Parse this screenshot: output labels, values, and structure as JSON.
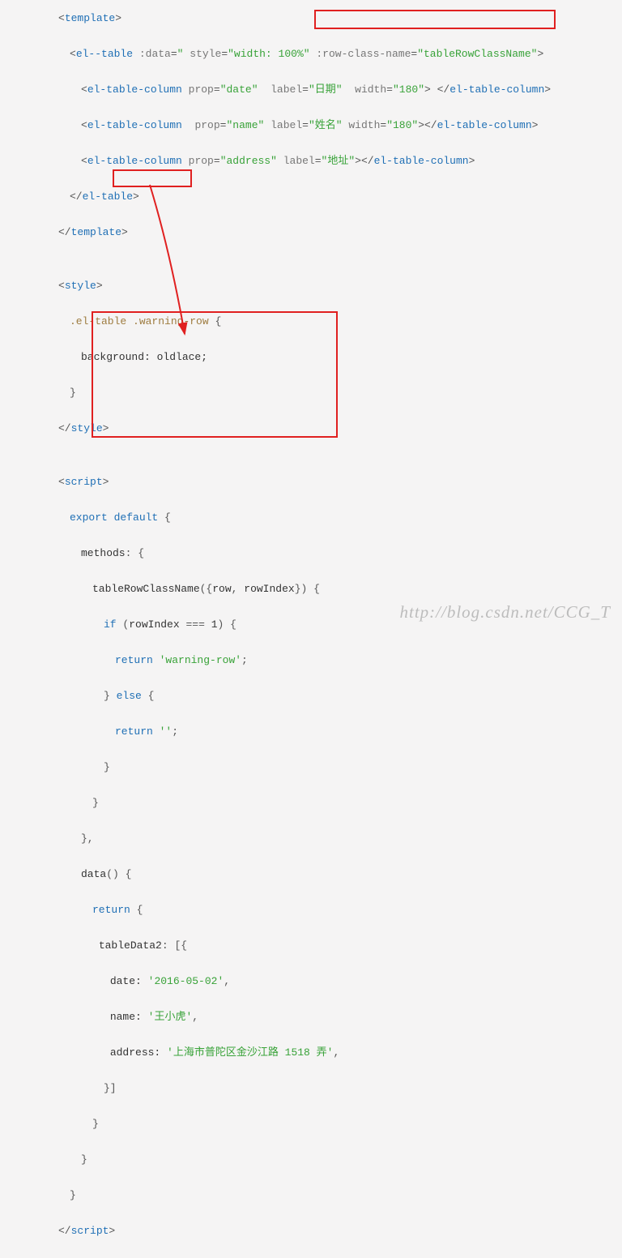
{
  "lines": {
    "template_open": "<template>",
    "el_table_open_1": "<el--table",
    "el_table_open_2": ":data=\"",
    "el_table_open_3": "style=\"width: 100%\"",
    "el_table_open_4": ":row-class-name=\"tableRowClassName\">",
    "col1_open": "<el-table-column",
    "col1_prop": "prop=\"date\"",
    "col1_label": "label=\"日期\"",
    "col1_width": "width=\"180\">",
    "col1_close": "</el-table-column>",
    "col2_open": "<el-table-column",
    "col2_prop": "prop=\"name\"",
    "col2_label": "label=\"姓名\"",
    "col2_width": "width=\"180\">",
    "col2_close": "</el-table-column>",
    "col3_open": "<el-table-column",
    "col3_prop": "prop=\"address\"",
    "col3_label": "label=\"地址\">",
    "col3_close": "</el-table-column>",
    "el_table_close": "</el-table>",
    "template_close": "</template>",
    "style_open": "<style>",
    "css_sel_1": ".el-table",
    "css_sel_2": ".warning-row",
    "css_brace": "{",
    "css_rule": "background: oldlace;",
    "css_close": "}",
    "style_close": "</style>",
    "script_open": "<script>",
    "export_default": "export default {",
    "methods_open": "methods: {",
    "fn_sig_1": "tableRowClassName",
    "fn_sig_2": "({row, rowIndex}) {",
    "if_cond": "if (rowIndex === 1) {",
    "return_warn_1": "return",
    "return_warn_2": "'warning-row'",
    "return_warn_3": ";",
    "else_kw": "} else {",
    "return_empty_1": "return",
    "return_empty_2": "''",
    "return_empty_3": ";",
    "brace_close_inner": "}",
    "brace_close_fn": "}",
    "methods_close": "},",
    "data_sig": "data() {",
    "return_open": "return {",
    "tabledata_open": "tableData2: [{",
    "date_k": "date:",
    "date_v": "'2016-05-02'",
    "comma": ",",
    "name_k": "name:",
    "name_v": "'王小虎'",
    "addr_k": "address:",
    "addr_v": "'上海市普陀区金沙江路 1518 弄'",
    "tabledata_close": "}]",
    "return_close": "}",
    "data_close": "}",
    "export_close": "}",
    "script_close": "</script>"
  },
  "watermark": "http://blog.csdn.net/CCG_T"
}
